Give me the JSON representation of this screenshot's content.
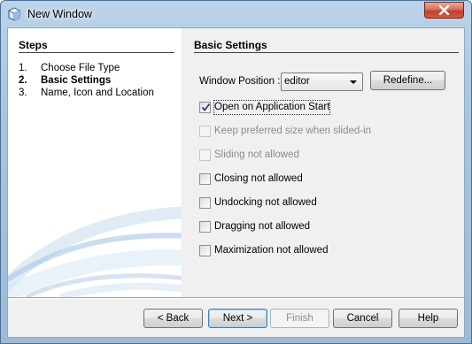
{
  "window": {
    "title": "New Window",
    "app_icon": "netbeans-cube-icon",
    "close_icon": "close-icon"
  },
  "steps": {
    "heading": "Steps",
    "items": [
      {
        "number": "1.",
        "label": "Choose File Type",
        "current": false
      },
      {
        "number": "2.",
        "label": "Basic Settings",
        "current": true
      },
      {
        "number": "3.",
        "label": "Name, Icon and Location",
        "current": false
      }
    ]
  },
  "settings": {
    "heading": "Basic Settings",
    "window_position_label": "Window Position :",
    "window_position_value": "editor",
    "redefine_label": "Redefine...",
    "checkboxes": [
      {
        "label": "Open on Application Start",
        "checked": true,
        "enabled": true
      },
      {
        "label": "Keep preferred size when slided-in",
        "checked": false,
        "enabled": false
      },
      {
        "label": "Sliding not allowed",
        "checked": false,
        "enabled": false
      },
      {
        "label": "Closing not allowed",
        "checked": false,
        "enabled": true
      },
      {
        "label": "Undocking not allowed",
        "checked": false,
        "enabled": true
      },
      {
        "label": "Dragging not allowed",
        "checked": false,
        "enabled": true
      },
      {
        "label": "Maximization not allowed",
        "checked": false,
        "enabled": true
      }
    ]
  },
  "footer": {
    "back_label": "< Back",
    "next_label": "Next >",
    "finish_label": "Finish",
    "cancel_label": "Cancel",
    "help_label": "Help"
  },
  "colors": {
    "title_bar": "#a9c6e0",
    "close_button": "#c1402a",
    "default_button_border": "#3c7fb1",
    "check_mark": "#1f3f7a",
    "decoration_blue": "#8fb3d6"
  }
}
